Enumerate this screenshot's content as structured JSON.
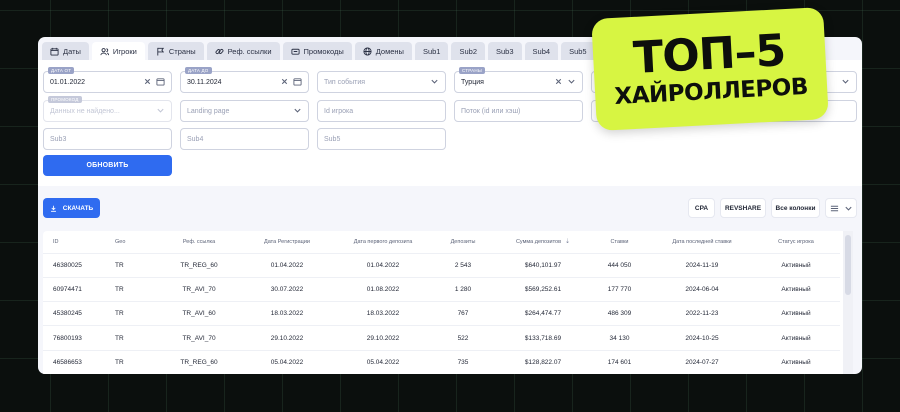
{
  "tabs": [
    {
      "label": "Даты",
      "icon": "calendar-icon"
    },
    {
      "label": "Игроки",
      "icon": "users-icon",
      "active": true
    },
    {
      "label": "Страны",
      "icon": "flag-icon"
    },
    {
      "label": "Реф. ссылки",
      "icon": "link-icon"
    },
    {
      "label": "Промокоды",
      "icon": "promo-icon"
    },
    {
      "label": "Домены",
      "icon": "globe-icon"
    },
    {
      "label": "Sub1"
    },
    {
      "label": "Sub2"
    },
    {
      "label": "Sub3"
    },
    {
      "label": "Sub4"
    },
    {
      "label": "Sub5"
    }
  ],
  "filters": {
    "date_from": {
      "tag": "ДАТА ОТ",
      "value": "01.01.2022"
    },
    "date_to": {
      "tag": "ДАТА ДО",
      "value": "30.11.2024"
    },
    "event_type": {
      "placeholder": "Тип события"
    },
    "country": {
      "tag": "СТРАНЫ",
      "value": "Турция"
    },
    "promo": {
      "tag": "ПРОМОКОД",
      "placeholder": "Данных не найдено..."
    },
    "landing": {
      "placeholder": "Landing page"
    },
    "player_id": {
      "placeholder": "Id игрока"
    },
    "stream": {
      "placeholder": "Поток (id или хэш)"
    },
    "sub3": {
      "placeholder": "Sub3"
    },
    "sub4": {
      "placeholder": "Sub4"
    },
    "sub5": {
      "placeholder": "Sub5"
    },
    "update_label": "ОБНОВИТЬ"
  },
  "toolbar": {
    "download_label": "СКАЧАТЬ",
    "cpa_label": "CPA",
    "revshare_label": "REVSHARE",
    "all_columns_label": "Все колонки"
  },
  "table": {
    "headers": [
      "ID",
      "Geo",
      "Реф. ссылка",
      "Дата Регистрации",
      "Дата первого депозита",
      "Депозиты",
      "Сумма депозитов",
      "Ставки",
      "Дата последней ставки",
      "Статус игрока"
    ],
    "rows": [
      [
        "46380025",
        "TR",
        "TR_REG_60",
        "01.04.2022",
        "01.04.2022",
        "2 543",
        "$640,101.97",
        "444 050",
        "2024-11-19",
        "Активный"
      ],
      [
        "60974471",
        "TR",
        "TR_AVI_70",
        "30.07.2022",
        "01.08.2022",
        "1 280",
        "$569,252.61",
        "177 770",
        "2024-06-04",
        "Активный"
      ],
      [
        "45380245",
        "TR",
        "TR_AVI_60",
        "18.03.2022",
        "18.03.2022",
        "767",
        "$264,474.77",
        "486 309",
        "2022-11-23",
        "Активный"
      ],
      [
        "76800193",
        "TR",
        "TR_AVI_70",
        "29.10.2022",
        "29.10.2022",
        "522",
        "$133,718.69",
        "34 130",
        "2024-10-25",
        "Активный"
      ],
      [
        "46586653",
        "TR",
        "TR_REG_60",
        "05.04.2022",
        "05.04.2022",
        "735",
        "$128,822.07",
        "174 601",
        "2024-07-27",
        "Активный"
      ]
    ]
  },
  "promo": {
    "line1": "ТОП–5",
    "line2": "ХАЙРОЛЛЕРОВ"
  },
  "colors": {
    "accent": "#2f6bf0",
    "sticker": "#d7f542",
    "background": "#0b0f0d"
  }
}
